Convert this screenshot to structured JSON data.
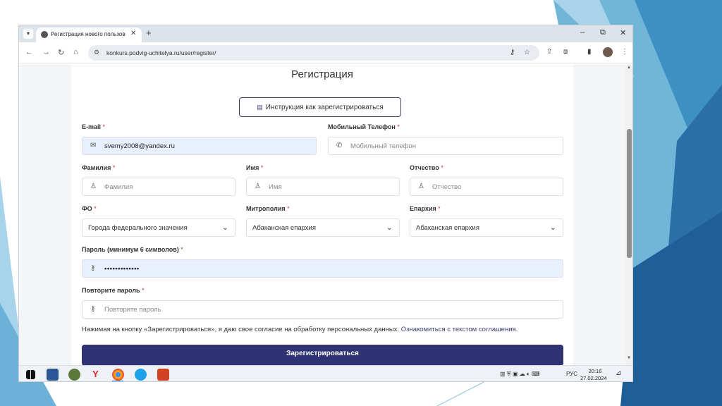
{
  "browser": {
    "menu_icon": "chevron-down-icon",
    "tab_title": "Регистрация нового пользова",
    "tab_close": "✕",
    "new_tab": "+",
    "minimize": "–",
    "restore": "⧉",
    "close": "✕",
    "url": "konkurs.podvig-uchitelya.ru/user/register/"
  },
  "page": {
    "title": "Регистрация",
    "instruction_button": "Инструкция как зарегистрироваться",
    "required_mark": "*"
  },
  "form": {
    "email": {
      "label": "E-mail",
      "value": "svemy2008@yandex.ru",
      "icon": "mail-icon"
    },
    "phone": {
      "label": "Мобильный Телефон",
      "placeholder": "Мобильный телефон",
      "icon": "phone-icon"
    },
    "surname": {
      "label": "Фамилия",
      "placeholder": "Фамилия",
      "icon": "user-icon"
    },
    "name": {
      "label": "Имя",
      "placeholder": "Имя",
      "icon": "user-icon"
    },
    "patronymic": {
      "label": "Отчество",
      "placeholder": "Отчество",
      "icon": "user-icon"
    },
    "fo": {
      "label": "ФО",
      "value": "Города федерального значения"
    },
    "metropolis": {
      "label": "Митрополия",
      "value": "Абаканская епархия"
    },
    "eparchy": {
      "label": "Епархия",
      "value": "Абаканская епархия"
    },
    "password": {
      "label": "Пароль (минимум 6 символов)",
      "value": "•••••••••••••",
      "icon": "key-icon"
    },
    "password_repeat": {
      "label": "Повторите пароль",
      "placeholder": "Повторите пароль",
      "icon": "key-icon"
    },
    "consent_text": "Нажимая на кнопку «Зарегистрироваться», я даю свое согласие на обработку персональных данных.",
    "consent_link": "Ознакомиться с текстом соглашения.",
    "submit": "Зарегистрироваться"
  },
  "taskbar": {
    "language": "РУС",
    "time": "20:16",
    "date": "27.02.2024"
  },
  "colors": {
    "accent": "#2f3373",
    "required": "#c0392b",
    "filled_field": "#e8f0fe"
  }
}
